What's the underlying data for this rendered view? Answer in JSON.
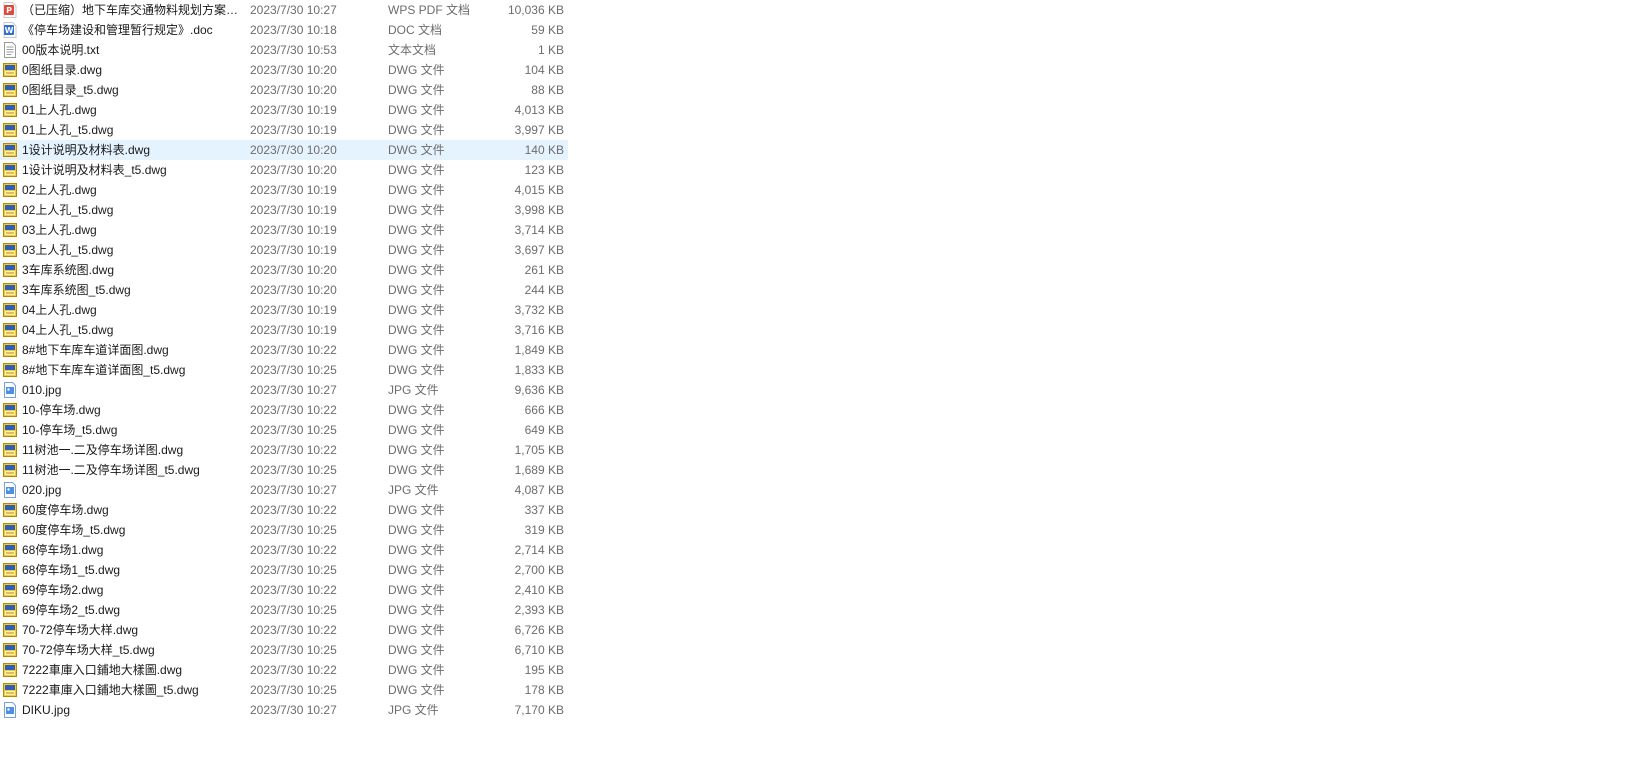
{
  "files": [
    {
      "name": "（已压缩）地下车库交通物料规划方案 - ...",
      "date": "2023/7/30 10:27",
      "type": "WPS PDF 文档",
      "size": "10,036 KB",
      "icon": "pdf"
    },
    {
      "name": "《停车场建设和管理暂行规定》.doc",
      "date": "2023/7/30 10:18",
      "type": "DOC 文档",
      "size": "59 KB",
      "icon": "doc"
    },
    {
      "name": "00版本说明.txt",
      "date": "2023/7/30 10:53",
      "type": "文本文档",
      "size": "1 KB",
      "icon": "txt"
    },
    {
      "name": "0图纸目录.dwg",
      "date": "2023/7/30 10:20",
      "type": "DWG 文件",
      "size": "104 KB",
      "icon": "dwg"
    },
    {
      "name": "0图纸目录_t5.dwg",
      "date": "2023/7/30 10:20",
      "type": "DWG 文件",
      "size": "88 KB",
      "icon": "dwg"
    },
    {
      "name": "01上人孔.dwg",
      "date": "2023/7/30 10:19",
      "type": "DWG 文件",
      "size": "4,013 KB",
      "icon": "dwg"
    },
    {
      "name": "01上人孔_t5.dwg",
      "date": "2023/7/30 10:19",
      "type": "DWG 文件",
      "size": "3,997 KB",
      "icon": "dwg"
    },
    {
      "name": "1设计说明及材料表.dwg",
      "date": "2023/7/30 10:20",
      "type": "DWG 文件",
      "size": "140 KB",
      "icon": "dwg",
      "selected": true
    },
    {
      "name": "1设计说明及材料表_t5.dwg",
      "date": "2023/7/30 10:20",
      "type": "DWG 文件",
      "size": "123 KB",
      "icon": "dwg"
    },
    {
      "name": "02上人孔.dwg",
      "date": "2023/7/30 10:19",
      "type": "DWG 文件",
      "size": "4,015 KB",
      "icon": "dwg"
    },
    {
      "name": "02上人孔_t5.dwg",
      "date": "2023/7/30 10:19",
      "type": "DWG 文件",
      "size": "3,998 KB",
      "icon": "dwg"
    },
    {
      "name": "03上人孔.dwg",
      "date": "2023/7/30 10:19",
      "type": "DWG 文件",
      "size": "3,714 KB",
      "icon": "dwg"
    },
    {
      "name": "03上人孔_t5.dwg",
      "date": "2023/7/30 10:19",
      "type": "DWG 文件",
      "size": "3,697 KB",
      "icon": "dwg"
    },
    {
      "name": "3车库系统图.dwg",
      "date": "2023/7/30 10:20",
      "type": "DWG 文件",
      "size": "261 KB",
      "icon": "dwg"
    },
    {
      "name": "3车库系统图_t5.dwg",
      "date": "2023/7/30 10:20",
      "type": "DWG 文件",
      "size": "244 KB",
      "icon": "dwg"
    },
    {
      "name": "04上人孔.dwg",
      "date": "2023/7/30 10:19",
      "type": "DWG 文件",
      "size": "3,732 KB",
      "icon": "dwg"
    },
    {
      "name": "04上人孔_t5.dwg",
      "date": "2023/7/30 10:19",
      "type": "DWG 文件",
      "size": "3,716 KB",
      "icon": "dwg"
    },
    {
      "name": "8#地下车库车道详面图.dwg",
      "date": "2023/7/30 10:22",
      "type": "DWG 文件",
      "size": "1,849 KB",
      "icon": "dwg"
    },
    {
      "name": "8#地下车库车道详面图_t5.dwg",
      "date": "2023/7/30 10:25",
      "type": "DWG 文件",
      "size": "1,833 KB",
      "icon": "dwg"
    },
    {
      "name": "010.jpg",
      "date": "2023/7/30 10:27",
      "type": "JPG 文件",
      "size": "9,636 KB",
      "icon": "jpg"
    },
    {
      "name": "10-停车场.dwg",
      "date": "2023/7/30 10:22",
      "type": "DWG 文件",
      "size": "666 KB",
      "icon": "dwg"
    },
    {
      "name": "10-停车场_t5.dwg",
      "date": "2023/7/30 10:25",
      "type": "DWG 文件",
      "size": "649 KB",
      "icon": "dwg"
    },
    {
      "name": "11树池一.二及停车场详图.dwg",
      "date": "2023/7/30 10:22",
      "type": "DWG 文件",
      "size": "1,705 KB",
      "icon": "dwg"
    },
    {
      "name": "11树池一.二及停车场详图_t5.dwg",
      "date": "2023/7/30 10:25",
      "type": "DWG 文件",
      "size": "1,689 KB",
      "icon": "dwg"
    },
    {
      "name": "020.jpg",
      "date": "2023/7/30 10:27",
      "type": "JPG 文件",
      "size": "4,087 KB",
      "icon": "jpg"
    },
    {
      "name": "60度停车场.dwg",
      "date": "2023/7/30 10:22",
      "type": "DWG 文件",
      "size": "337 KB",
      "icon": "dwg"
    },
    {
      "name": "60度停车场_t5.dwg",
      "date": "2023/7/30 10:25",
      "type": "DWG 文件",
      "size": "319 KB",
      "icon": "dwg"
    },
    {
      "name": "68停车场1.dwg",
      "date": "2023/7/30 10:22",
      "type": "DWG 文件",
      "size": "2,714 KB",
      "icon": "dwg"
    },
    {
      "name": "68停车场1_t5.dwg",
      "date": "2023/7/30 10:25",
      "type": "DWG 文件",
      "size": "2,700 KB",
      "icon": "dwg"
    },
    {
      "name": "69停车场2.dwg",
      "date": "2023/7/30 10:22",
      "type": "DWG 文件",
      "size": "2,410 KB",
      "icon": "dwg"
    },
    {
      "name": "69停车场2_t5.dwg",
      "date": "2023/7/30 10:25",
      "type": "DWG 文件",
      "size": "2,393 KB",
      "icon": "dwg"
    },
    {
      "name": "70-72停车场大样.dwg",
      "date": "2023/7/30 10:22",
      "type": "DWG 文件",
      "size": "6,726 KB",
      "icon": "dwg"
    },
    {
      "name": "70-72停车场大样_t5.dwg",
      "date": "2023/7/30 10:25",
      "type": "DWG 文件",
      "size": "6,710 KB",
      "icon": "dwg"
    },
    {
      "name": "7222車庫入口鋪地大樣圖.dwg",
      "date": "2023/7/30 10:22",
      "type": "DWG 文件",
      "size": "195 KB",
      "icon": "dwg"
    },
    {
      "name": "7222車庫入口鋪地大樣圖_t5.dwg",
      "date": "2023/7/30 10:25",
      "type": "DWG 文件",
      "size": "178 KB",
      "icon": "dwg"
    },
    {
      "name": "DIKU.jpg",
      "date": "2023/7/30 10:27",
      "type": "JPG 文件",
      "size": "7,170 KB",
      "icon": "jpg"
    }
  ]
}
